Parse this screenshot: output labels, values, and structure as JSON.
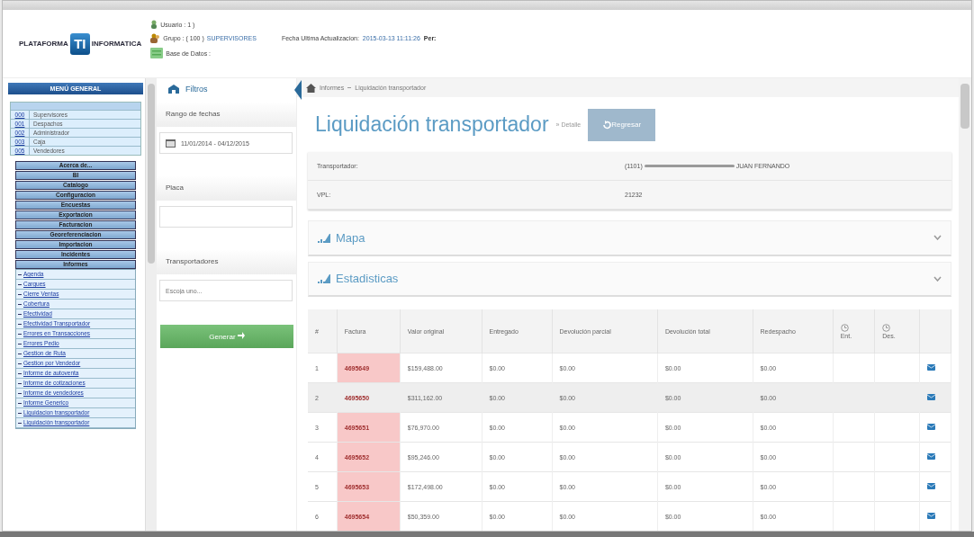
{
  "header": {
    "brand_left": "PLATAFORMA",
    "brand_logo": "TI",
    "brand_right": "INFORMATICA",
    "user": "Usuario : 1      )",
    "group_label": "Grupo : ( 100 )",
    "group_value": "SUPERVISORES",
    "database": "Base de Datos :",
    "update_label": "Fecha Ultima Actualizacion:",
    "update_value": "2015-03-13 11:11:26",
    "per": "Per:"
  },
  "sidebar": {
    "title": "MENÚ GENERAL",
    "codes": [
      {
        "code": "000",
        "name": "Supervisores"
      },
      {
        "code": "001",
        "name": "Despachos"
      },
      {
        "code": "002",
        "name": "Administrador"
      },
      {
        "code": "003",
        "name": "Caja"
      },
      {
        "code": "005",
        "name": "Vendedores"
      }
    ],
    "categories": [
      "Acerca de...",
      "BI",
      "Catalogo",
      "Configuracion",
      "Encuestas",
      "Exportacion",
      "Facturacion",
      "Georeferenciacion",
      "Importacion",
      "Incidentes",
      "Informes"
    ],
    "links": [
      "Agenda",
      "Cargues",
      "Cierre Ventas",
      "Cobertura",
      "Efectividad",
      "Efectividad Transportador",
      "Errores en Transacciones",
      "Errores Pedio",
      "Gestion de Ruta",
      "Gestion por Vendedor",
      "Informe de autoventa",
      "Informe de cotizaciones",
      "Informe de vendedores",
      "Informe Generico",
      "Liquidacion transportador",
      "Liquidación transportador"
    ]
  },
  "filters": {
    "title": "Filtros",
    "groups": [
      {
        "kind": "date",
        "label": "Rango de fechas",
        "value": "11/01/2014 - 04/12/2015"
      },
      {
        "kind": "text",
        "label": "Placa"
      },
      {
        "kind": "select",
        "label": "Transportadores",
        "placeholder": "Escoja uno..."
      }
    ],
    "button": "Generar"
  },
  "breadcrumb": [
    "Informes",
    "Liquidación transportador"
  ],
  "page": {
    "title": "Liquidación transportador",
    "subtitle": "» Detalle",
    "back_button": "Regresar"
  },
  "info": [
    {
      "label": "Transportador:",
      "value": "(1101)",
      "value_after": "JUAN FERNANDO",
      "redacted": true
    },
    {
      "label": "VPL:",
      "value": "21232",
      "redacted": false
    }
  ],
  "panels": [
    "Mapa",
    "Estadisticas"
  ],
  "table": {
    "columns": [
      {
        "label": "#"
      },
      {
        "label": "Factura"
      },
      {
        "label": "Valor original"
      },
      {
        "label": "Entregado"
      },
      {
        "label": "Devolución parcial"
      },
      {
        "label": "Devolución total"
      },
      {
        "label": "Redespacho"
      },
      {
        "label": "Ent.",
        "clock": true
      },
      {
        "label": "Des.",
        "clock": true
      },
      {
        "kind": "action"
      }
    ],
    "rows": [
      {
        "cells": [
          "1",
          "4695649",
          "$159,488.00",
          "$0.00",
          "$0.00",
          "$0.00",
          "$0.00"
        ],
        "highlighted": false
      },
      {
        "cells": [
          "2",
          "4695650",
          "$311,162.00",
          "$0.00",
          "$0.00",
          "$0.00",
          "$0.00"
        ],
        "highlighted": true
      },
      {
        "cells": [
          "3",
          "4695651",
          "$76,970.00",
          "$0.00",
          "$0.00",
          "$0.00",
          "$0.00"
        ],
        "highlighted": false
      },
      {
        "cells": [
          "4",
          "4695652",
          "$95,246.00",
          "$0.00",
          "$0.00",
          "$0.00",
          "$0.00"
        ],
        "highlighted": false
      },
      {
        "cells": [
          "5",
          "4695653",
          "$172,498.00",
          "$0.00",
          "$0.00",
          "$0.00",
          "$0.00"
        ],
        "highlighted": false
      },
      {
        "cells": [
          "6",
          "4695654",
          "$50,359.00",
          "$0.00",
          "$0.00",
          "$0.00",
          "$0.00"
        ],
        "highlighted": false
      }
    ]
  }
}
